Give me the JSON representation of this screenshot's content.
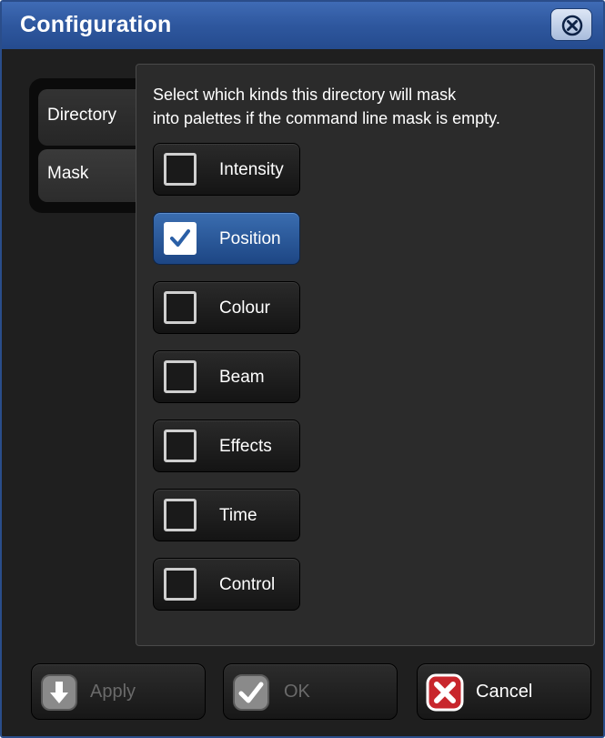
{
  "window": {
    "title": "Configuration",
    "title_bar_color": "#2e579e"
  },
  "close_icon": "close-icon",
  "side_tabs": [
    {
      "label": "Directory",
      "selected": false
    },
    {
      "label": "Mask",
      "selected": true
    }
  ],
  "panel": {
    "instructions_line1": "Select which kinds this directory will mask",
    "instructions_line2": "into palettes if the command line mask is empty."
  },
  "options": [
    {
      "label": "Intensity",
      "checked": false
    },
    {
      "label": "Position",
      "checked": true
    },
    {
      "label": "Colour",
      "checked": false
    },
    {
      "label": "Beam",
      "checked": false
    },
    {
      "label": "Effects",
      "checked": false
    },
    {
      "label": "Time",
      "checked": false
    },
    {
      "label": "Control",
      "checked": false
    }
  ],
  "buttons": {
    "apply": {
      "label": "Apply",
      "enabled": false,
      "icon": "arrow-down-icon"
    },
    "ok": {
      "label": "OK",
      "enabled": false,
      "icon": "check-icon"
    },
    "cancel": {
      "label": "Cancel",
      "enabled": true,
      "icon": "x-icon"
    }
  },
  "colors": {
    "accent": "#2e579e",
    "checked_option": "#2a5a9e",
    "cancel_icon": "#c8262c"
  }
}
